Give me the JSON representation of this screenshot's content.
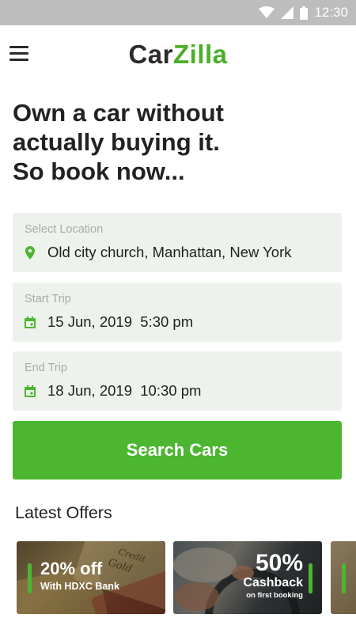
{
  "status_bar": {
    "time": "12:30"
  },
  "app": {
    "logo_part1": "Car",
    "logo_part2": "Zilla"
  },
  "headline": {
    "line1": "Own a car without",
    "line2": "actually buying it.",
    "line3": "So book now..."
  },
  "location": {
    "label": "Select Location",
    "value": "Old city church, Manhattan, New York",
    "icon": "location-pin-icon"
  },
  "start_trip": {
    "label": "Start Trip",
    "value": "15 Jun, 2019  5:30 pm",
    "icon": "calendar-icon"
  },
  "end_trip": {
    "label": "End Trip",
    "value": "18 Jun, 2019  10:30 pm",
    "icon": "calendar-icon"
  },
  "search_button": "Search Cars",
  "offers": {
    "title": "Latest Offers",
    "cards": [
      {
        "headline": "20% off",
        "subline": "With HDXC Bank",
        "card_text1": "Credit",
        "card_text2": "Gold"
      },
      {
        "headline": "50%",
        "subline": "Cashback",
        "note": "on first booking"
      }
    ]
  },
  "colors": {
    "accent": "#4cb630",
    "field_bg": "#eef2ec",
    "status_bar": "#bdbdbd"
  }
}
